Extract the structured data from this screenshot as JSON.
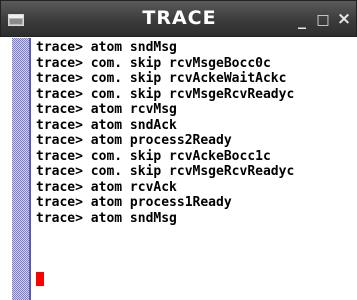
{
  "window": {
    "title": "TRACE",
    "icon": "terminal-window-icon",
    "controls": {
      "minimize": "_",
      "maximize": "□",
      "close": "×"
    }
  },
  "terminal": {
    "lines": [
      "trace> atom sndMsg",
      "trace> com. skip rcvMsgeBocc0c",
      "trace> com. skip rcvAckeWaitAckc",
      "trace> com. skip rcvMsgeRcvReadyc",
      "trace> atom rcvMsg",
      "trace> atom sndAck",
      "trace> atom process2Ready",
      "trace> com. skip rcvAckeBocc1c",
      "trace> com. skip rcvMsgeRcvReadyc",
      "trace> atom rcvAck",
      "trace> atom process1Ready",
      "trace> atom sndMsg"
    ],
    "cursor_color": "#ff0000"
  },
  "colors": {
    "titlebar": "#3c3c3c",
    "scrollbar": "#7e7ed2",
    "text": "#000000",
    "background": "#ffffff"
  }
}
